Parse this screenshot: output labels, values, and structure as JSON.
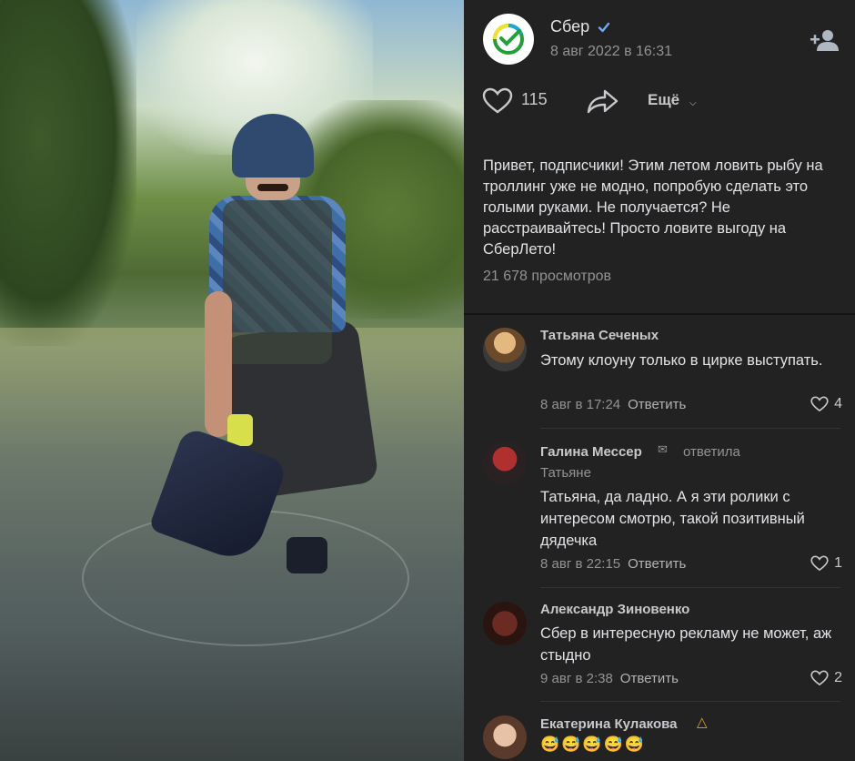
{
  "post": {
    "author": "Сбер",
    "date": "8 авг 2022 в 16:31",
    "likes": "115",
    "more_label": "Ещё",
    "text": "Привет, подписчики! Этим летом ловить рыбу на троллинг уже не модно, попробую сделать это голыми руками. Не получается? Не расстраивайтесь! Просто ловите выгоду на СберЛето!",
    "views": "21 678 просмотров"
  },
  "icons": {
    "logo": "sber-logo-icon",
    "verified": "verified-check-icon",
    "add_friend": "add-friend-icon",
    "like": "heart-icon",
    "share": "share-arrow-icon",
    "more": "chevron-down-icon"
  },
  "colors": {
    "panel_bg": "#222222",
    "accent_blue": "#71aaeb",
    "sber_green": "#21a038"
  },
  "comments": [
    {
      "name": "Татьяна Сеченых",
      "reply_to": "",
      "reply_to_2": "",
      "text": "Этому клоуну только в цирке выступать.",
      "date": "8 авг в 17:24",
      "reply_label": "Ответить",
      "likes": "4"
    },
    {
      "name": "Галина Мессер",
      "reply_to": "ответила",
      "reply_to_2": "Татьяне",
      "text": "Татьяна, да ладно. А я эти ролики с интересом смотрю, такой позитивный дядечка",
      "date": "8 авг в 22:15",
      "reply_label": "Ответить",
      "likes": "1"
    },
    {
      "name": "Александр Зиновенко",
      "reply_to": "",
      "reply_to_2": "",
      "text": "Сбер в интересную рекламу не может, аж стыдно",
      "date": "9 авг в 2:38",
      "reply_label": "Ответить",
      "likes": "2"
    },
    {
      "name": "Екатерина Кулакова",
      "reply_to": "",
      "reply_to_2": "",
      "text": "😅😅😅😅😅",
      "date": "",
      "reply_label": "",
      "likes": ""
    }
  ]
}
